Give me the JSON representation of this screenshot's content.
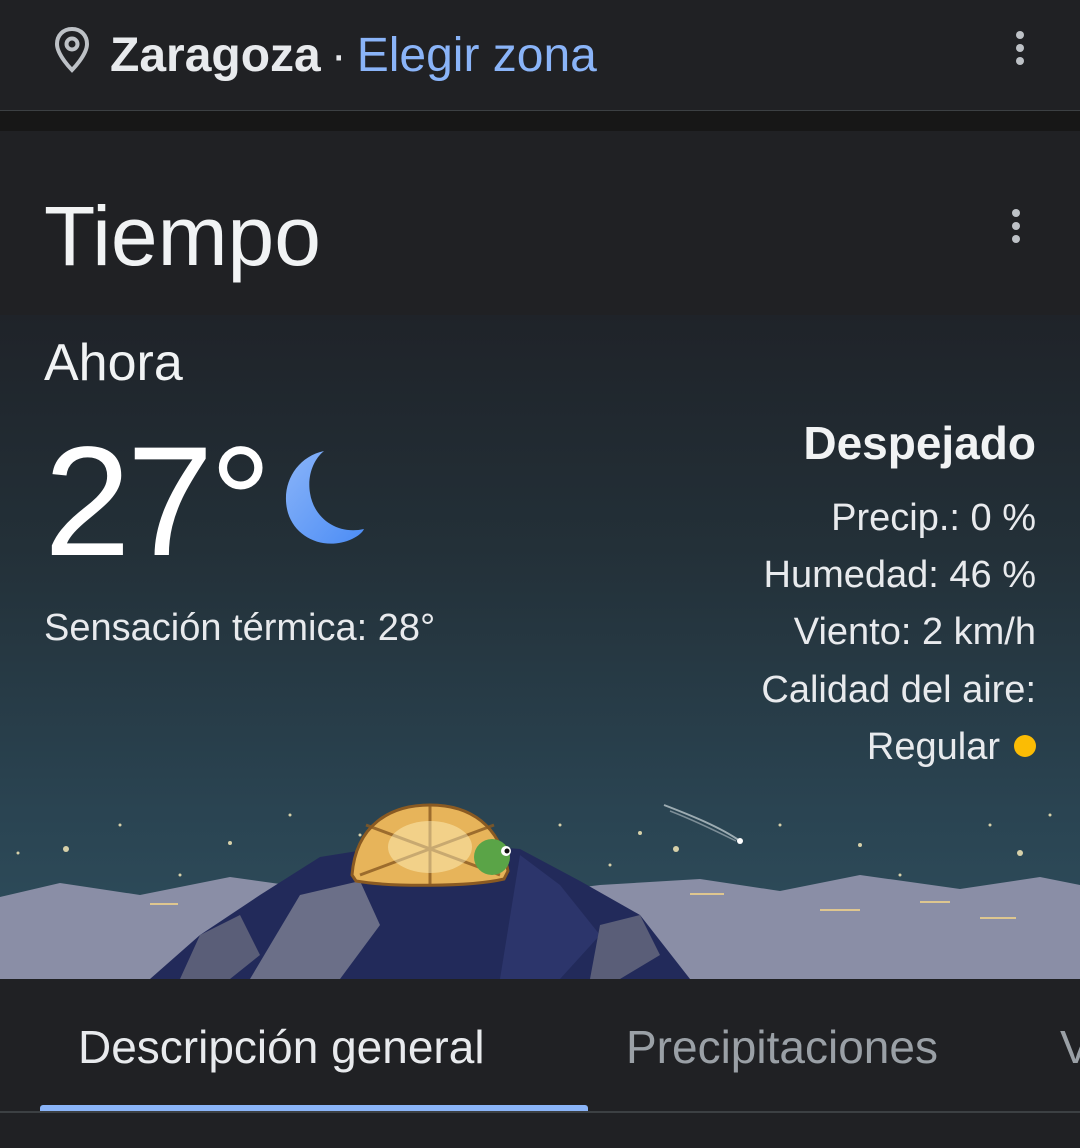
{
  "location": {
    "city": "Zaragoza",
    "separator": "·",
    "change_link": "Elegir zona",
    "icon": "location-pin-icon"
  },
  "card": {
    "title": "Tiempo",
    "menu_icon": "more-vert-icon"
  },
  "current": {
    "label": "Ahora",
    "temperature": "27°",
    "condition_icon": "moon-icon",
    "feels_like": "Sensación térmica: 28°",
    "condition": "Despejado",
    "precip": "Precip.: 0 %",
    "humidity": "Humedad: 46 %",
    "wind": "Viento: 2 km/h",
    "air_quality_label": "Calidad del aire:",
    "air_quality_value": "Regular",
    "air_quality_color": "#fbbc04"
  },
  "tabs": [
    {
      "label": "Descripción general",
      "active": true
    },
    {
      "label": "Precipitaciones",
      "active": false
    },
    {
      "label": "V",
      "active": false
    }
  ],
  "colors": {
    "accent": "#8ab4f8",
    "background": "#202124",
    "moon": "#669df6"
  }
}
